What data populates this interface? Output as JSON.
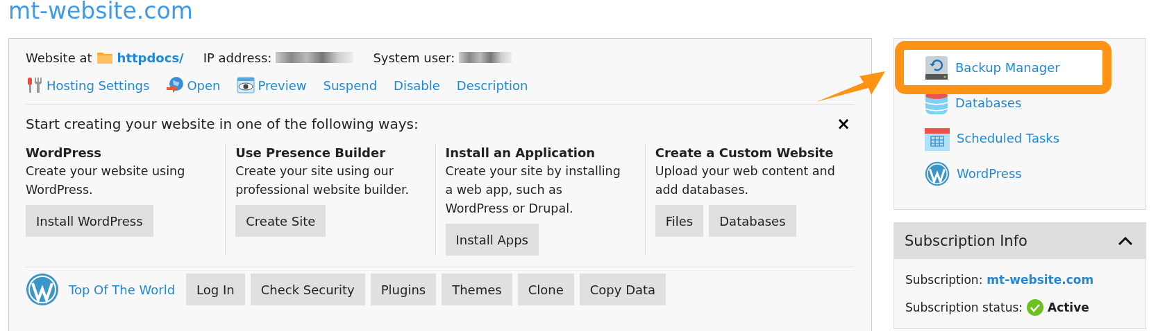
{
  "title": "mt-website.com",
  "info": {
    "website_label": "Website at",
    "folder": "httpdocs/",
    "ip_label": "IP address:",
    "user_label": "System user:"
  },
  "actions": [
    {
      "label": "Hosting Settings",
      "kind": "tools"
    },
    {
      "label": "Open",
      "kind": "globe"
    },
    {
      "label": "Preview",
      "kind": "eye"
    },
    {
      "label": "Suspend",
      "kind": "plain"
    },
    {
      "label": "Disable",
      "kind": "plain"
    },
    {
      "label": "Description",
      "kind": "plain"
    }
  ],
  "start": {
    "heading": "Start creating your website in one of the following ways:",
    "close": "×",
    "options": [
      {
        "title": "WordPress",
        "text": "Create your website using WordPress.",
        "buttons": [
          "Install WordPress"
        ]
      },
      {
        "title": "Use Presence Builder",
        "text": "Create your site using our professional website builder.",
        "buttons": [
          "Create Site"
        ]
      },
      {
        "title": "Install an Application",
        "text": "Create your site by installing a web app, such as WordPress or Drupal.",
        "buttons": [
          "Install Apps"
        ]
      },
      {
        "title": "Create a Custom Website",
        "text": "Upload your web content and add databases.",
        "buttons": [
          "Files",
          "Databases"
        ]
      }
    ]
  },
  "wordpress": {
    "site": "Top Of The World",
    "buttons": [
      "Log In",
      "Check Security",
      "Plugins",
      "Themes",
      "Clone",
      "Copy Data"
    ]
  },
  "sidebar": {
    "items": [
      {
        "label": "Backup Manager",
        "kind": "backup",
        "highlighted": true
      },
      {
        "label": "Databases",
        "kind": "database",
        "highlighted": false
      },
      {
        "label": "Scheduled Tasks",
        "kind": "calendar",
        "highlighted": false
      },
      {
        "label": "WordPress",
        "kind": "wordpress",
        "highlighted": false
      }
    ]
  },
  "subscription": {
    "title": "Subscription Info",
    "expanded": true,
    "rows": [
      {
        "label": "Subscription:",
        "value": "mt-website.com",
        "kind": "link"
      },
      {
        "label": "Subscription status:",
        "value": "Active",
        "kind": "status"
      }
    ]
  }
}
